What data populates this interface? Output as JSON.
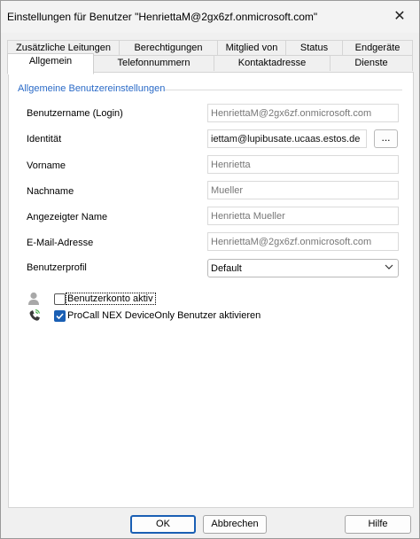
{
  "window": {
    "title": "Einstellungen für Benutzer \"HenriettaM@2gx6zf.onmicrosoft.com\"",
    "close_glyph": "✕"
  },
  "tabs_row1": [
    "Zusätzliche Leitungen",
    "Berechtigungen",
    "Mitglied von",
    "Status",
    "Endgeräte"
  ],
  "tabs_row2": [
    "Allgemein",
    "Telefonnummern",
    "Kontaktadresse",
    "Dienste"
  ],
  "active_tab": "Allgemein",
  "section": {
    "title": "Allgemeine Benutzereinstellungen"
  },
  "fields": {
    "username": {
      "label": "Benutzername (Login)",
      "value": "HenriettaM@2gx6zf.onmicrosoft.com"
    },
    "identity": {
      "label": "Identität",
      "value": "iettam@lupibusate.ucaas.estos.de",
      "button": "..."
    },
    "firstname": {
      "label": "Vorname",
      "value": "Henrietta"
    },
    "lastname": {
      "label": "Nachname",
      "value": "Mueller"
    },
    "displayname": {
      "label": "Angezeigter Name",
      "value": "Henrietta Mueller"
    },
    "email": {
      "label": "E-Mail-Adresse",
      "value": "HenriettaM@2gx6zf.onmicrosoft.com"
    },
    "profile": {
      "label": "Benutzerprofil",
      "value": "Default"
    }
  },
  "options": {
    "account_active": {
      "label": "Benutzerkonto aktiv",
      "checked": false,
      "icon": "user-icon"
    },
    "procall_nex": {
      "label": "ProCall NEX DeviceOnly Benutzer aktivieren",
      "checked": true,
      "icon": "phone-icon"
    }
  },
  "buttons": {
    "ok": "OK",
    "cancel": "Abbrechen",
    "help": "Hilfe"
  },
  "colors": {
    "accent": "#1a5fb4",
    "section_title": "#2a6ac7"
  }
}
